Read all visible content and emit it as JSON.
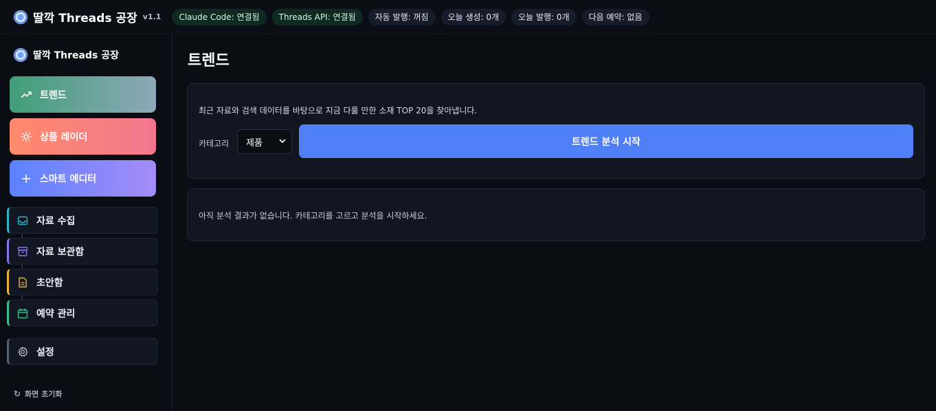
{
  "app": {
    "title": "딸깍 Threads 공장",
    "version": "v1.1"
  },
  "status": {
    "claude": "Claude Code: 연결됨",
    "threads_api": "Threads API: 연결됨",
    "auto_publish": "자동 발행: 꺼짐",
    "today_created": "오늘 생성: 0개",
    "today_published": "오늘 발행: 0개",
    "next_schedule": "다음 예약: 없음"
  },
  "sidebar": {
    "brand": "딸깍 Threads 공장",
    "primary": [
      {
        "label": "트렌드",
        "icon": "trending-up-icon"
      },
      {
        "label": "상품 레이더",
        "icon": "sun-icon"
      },
      {
        "label": "스마트 에디터",
        "icon": "plus-icon"
      }
    ],
    "nav": [
      {
        "label": "자료 수집",
        "icon": "inbox-icon",
        "color": "#2bb3c6"
      },
      {
        "label": "자료 보관함",
        "icon": "archive-icon",
        "color": "#8b74e6"
      },
      {
        "label": "초안함",
        "icon": "document-icon",
        "color": "#e8b23c"
      },
      {
        "label": "예약 관리",
        "icon": "calendar-icon",
        "color": "#3cbf8e"
      },
      {
        "label": "설정",
        "icon": "gear-icon",
        "color": "#5a6275"
      }
    ],
    "reset": "화면 초기화"
  },
  "main": {
    "title": "트렌드",
    "description": "최근 자료와 검색 데이터를 바탕으로 지금 다룰 만한 소재 TOP 20을 찾아냅니다.",
    "category_label": "카테고리",
    "category_value": "제품",
    "start_button": "트렌드 분석 시작",
    "empty_message": "아직 분석 결과가 없습니다. 카테고리를 고르고 분석을 시작하세요."
  },
  "colors": {
    "accent": "#4f7ff7",
    "ok_bg": "#0f2a22"
  }
}
